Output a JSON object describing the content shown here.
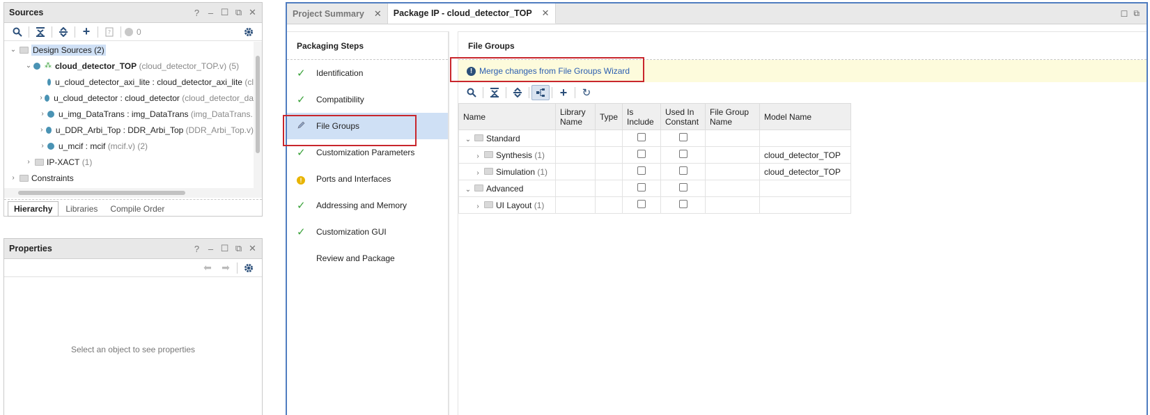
{
  "sources": {
    "title": "Sources",
    "header_icons": [
      "question-icon",
      "minimize-icon",
      "maximize-icon",
      "float-icon",
      "close-icon"
    ],
    "toolbar": {
      "badge_count": "0"
    },
    "tree": {
      "design_sources": {
        "label": "Design Sources",
        "count": "(2)"
      },
      "top": {
        "name": "cloud_detector_TOP",
        "file": "(cloud_detector_TOP.v)",
        "count": "(5)"
      },
      "children": [
        {
          "name": "u_cloud_detector_axi_lite : cloud_detector_axi_lite",
          "file": "(cl"
        },
        {
          "name": "u_cloud_detector : cloud_detector",
          "file": "(cloud_detector_da"
        },
        {
          "name": "u_img_DataTrans : img_DataTrans",
          "file": "(img_DataTrans."
        },
        {
          "name": "u_DDR_Arbi_Top : DDR_Arbi_Top",
          "file": "(DDR_Arbi_Top.v)"
        },
        {
          "name": "u_mcif : mcif",
          "file": "(mcif.v) (2)"
        }
      ],
      "ipxact": {
        "label": "IP-XACT",
        "count": "(1)"
      },
      "constraints": {
        "label": "Constraints"
      }
    },
    "tabs": [
      "Hierarchy",
      "Libraries",
      "Compile Order"
    ]
  },
  "properties": {
    "title": "Properties",
    "empty_message": "Select an object to see properties"
  },
  "main": {
    "tabs": [
      {
        "label": "Project Summary"
      },
      {
        "label": "Package IP - cloud_detector_TOP"
      }
    ],
    "steps_title": "Packaging Steps",
    "steps": [
      {
        "label": "Identification",
        "status": "done"
      },
      {
        "label": "Compatibility",
        "status": "done"
      },
      {
        "label": "File Groups",
        "status": "editing"
      },
      {
        "label": "Customization Parameters",
        "status": "done"
      },
      {
        "label": "Ports and Interfaces",
        "status": "warning"
      },
      {
        "label": "Addressing and Memory",
        "status": "done"
      },
      {
        "label": "Customization GUI",
        "status": "done"
      },
      {
        "label": "Review and Package",
        "status": "none"
      }
    ],
    "file_groups": {
      "title": "File Groups",
      "banner": "Merge changes from File Groups Wizard",
      "columns": [
        "Name",
        "Library Name",
        "Type",
        "Is Include",
        "Used In Constant",
        "File Group Name",
        "Model Name"
      ],
      "rows": [
        {
          "level": 0,
          "name": "Standard",
          "count": "",
          "model": ""
        },
        {
          "level": 1,
          "name": "Synthesis",
          "count": "(1)",
          "model": "cloud_detector_TOP"
        },
        {
          "level": 1,
          "name": "Simulation",
          "count": "(1)",
          "model": "cloud_detector_TOP"
        },
        {
          "level": 0,
          "name": "Advanced",
          "count": "",
          "model": ""
        },
        {
          "level": 1,
          "name": "UI Layout",
          "count": "(1)",
          "model": ""
        }
      ]
    }
  },
  "colors": {
    "accent_border": "#4f7cc0",
    "selection": "#cfe0f5",
    "highlight_box": "#c8262c",
    "check": "#3aa23a",
    "warning": "#e8b400",
    "banner_bg": "#fdfbdc"
  }
}
